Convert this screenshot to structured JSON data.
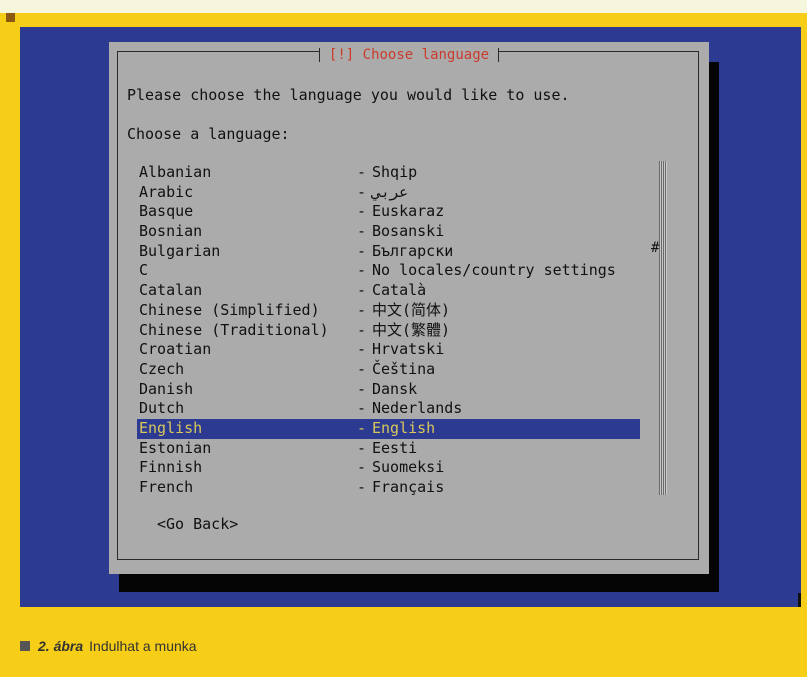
{
  "dialog": {
    "title": "[!] Choose language",
    "prompt": "Please choose the language you would like to use.",
    "label": "Choose a language:",
    "languages": [
      {
        "name": "Albanian",
        "native": "Shqip"
      },
      {
        "name": "Arabic",
        "native": "عربي"
      },
      {
        "name": "Basque",
        "native": "Euskaraz"
      },
      {
        "name": "Bosnian",
        "native": "Bosanski"
      },
      {
        "name": "Bulgarian",
        "native": "Български"
      },
      {
        "name": "C",
        "native": "No locales/country settings"
      },
      {
        "name": "Catalan",
        "native": "Català"
      },
      {
        "name": "Chinese (Simplified)",
        "native": "中文(简体)"
      },
      {
        "name": "Chinese (Traditional)",
        "native": "中文(繁體)"
      },
      {
        "name": "Croatian",
        "native": "Hrvatski"
      },
      {
        "name": "Czech",
        "native": "Čeština"
      },
      {
        "name": "Danish",
        "native": "Dansk"
      },
      {
        "name": "Dutch",
        "native": "Nederlands"
      },
      {
        "name": "English",
        "native": "English"
      },
      {
        "name": "Estonian",
        "native": "Eesti"
      },
      {
        "name": "Finnish",
        "native": "Suomeksi"
      },
      {
        "name": "French",
        "native": "Français"
      }
    ],
    "selected_index": 13,
    "separator": "-",
    "scroll_thumb": "#",
    "go_back": "<Go Back>"
  },
  "caption": {
    "number": "2. ábra",
    "text": "Indulhat a munka"
  },
  "colors": {
    "frame": "#f7ce17",
    "screen": "#2d3a92",
    "dialog": "#ababab",
    "title": "#cb3b2d",
    "selected_text": "#d8c85a"
  }
}
